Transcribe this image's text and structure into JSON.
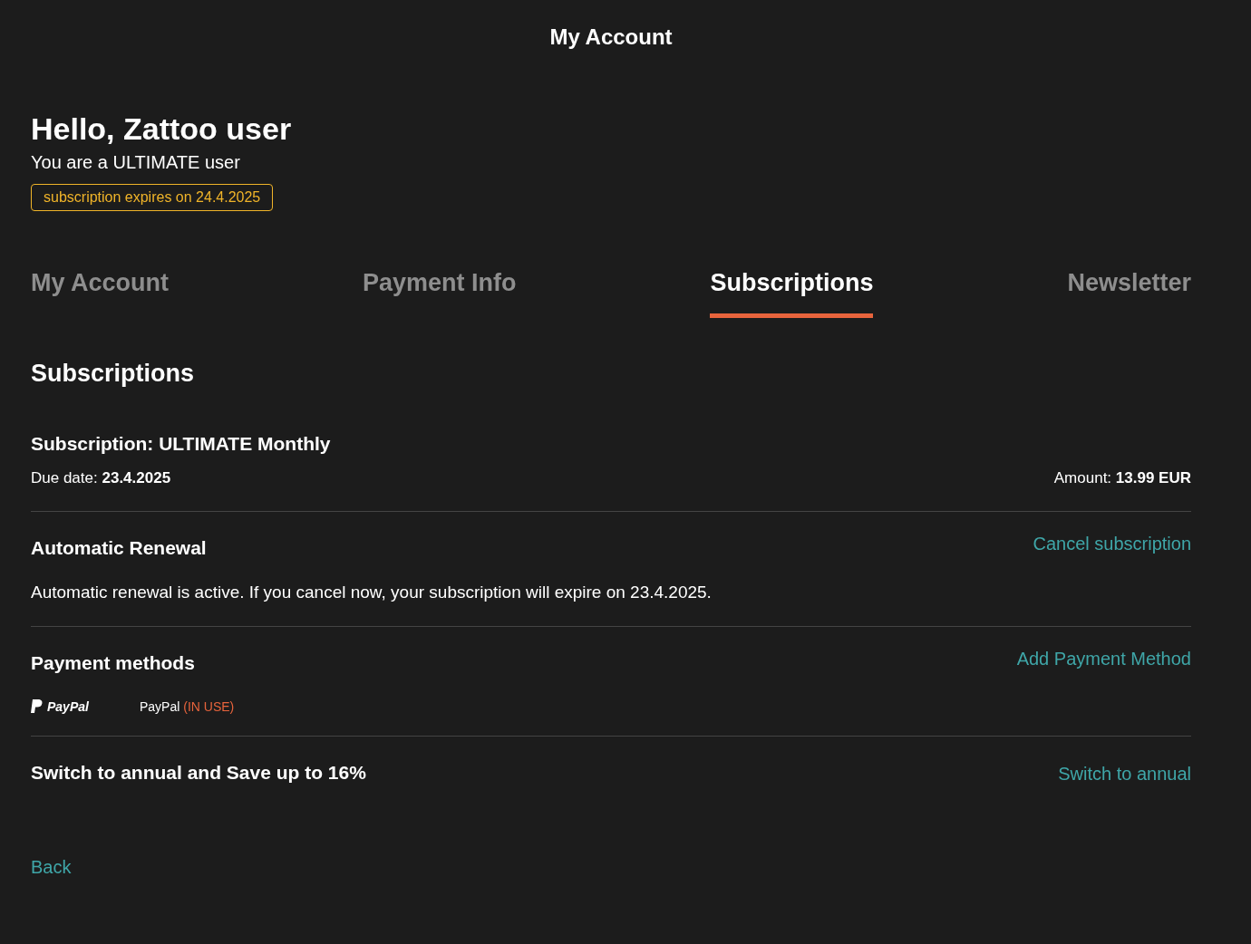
{
  "header": {
    "title": "My Account"
  },
  "greeting": {
    "title": "Hello, Zattoo user",
    "subtitle": "You are a ULTIMATE user",
    "badge": "subscription expires on 24.4.2025"
  },
  "tabs": [
    {
      "label": "My Account",
      "selected": false
    },
    {
      "label": "Payment Info",
      "selected": false
    },
    {
      "label": "Subscriptions",
      "selected": true
    },
    {
      "label": "Newsletter",
      "selected": false
    }
  ],
  "section_title": "Subscriptions",
  "subscription": {
    "title": "Subscription: ULTIMATE Monthly",
    "due_label": "Due date:",
    "due_value": "23.4.2025",
    "amount_label": "Amount:",
    "amount_value": "13.99 EUR"
  },
  "renewal": {
    "title": "Automatic Renewal",
    "action": "Cancel subscription",
    "text": "Automatic renewal is active. If you cancel now, your subscription will expire on 23.4.2025."
  },
  "payment": {
    "title": "Payment methods",
    "action": "Add Payment Method",
    "methods": [
      {
        "logo": "PayPal",
        "name": "PayPal",
        "status": "(IN USE)"
      }
    ]
  },
  "annual": {
    "title": "Switch to annual and Save up to 16%",
    "action": "Switch to annual"
  },
  "back": "Back"
}
